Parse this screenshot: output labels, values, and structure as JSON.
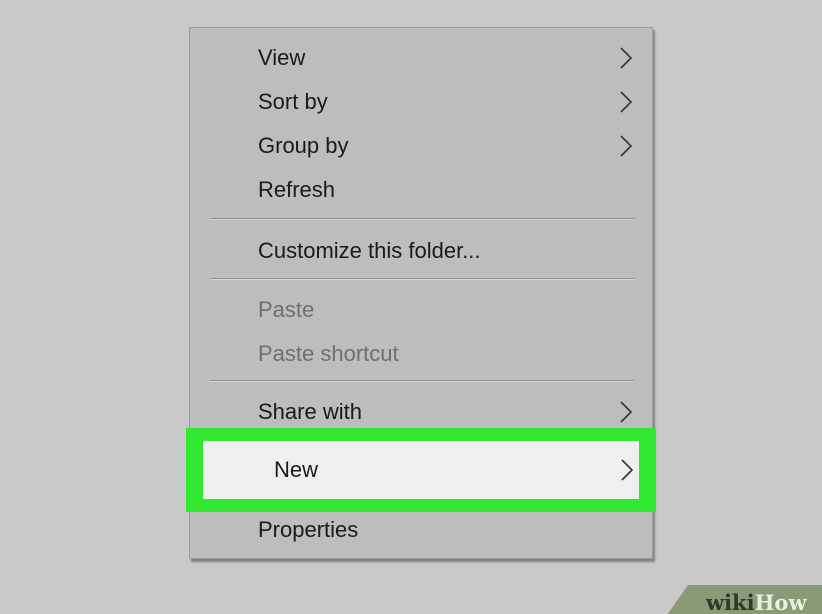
{
  "menu": {
    "view_label": "View",
    "sort_by_label": "Sort by",
    "group_by_label": "Group by",
    "refresh_label": "Refresh",
    "customize_label": "Customize this folder...",
    "paste_label": "Paste",
    "paste_shortcut_label": "Paste shortcut",
    "share_with_label": "Share with",
    "new_label": "New",
    "properties_label": "Properties"
  },
  "icons": {
    "submenu_arrow": "chevron-right-icon"
  },
  "colors": {
    "background": "#c9c9c9",
    "menu_background": "#bdbdbd",
    "highlight_border": "#2fe82f",
    "highlight_fill": "#efefef",
    "disabled_text": "#6f6f6f"
  },
  "watermark": {
    "part1": "wiki",
    "part2": "How"
  }
}
